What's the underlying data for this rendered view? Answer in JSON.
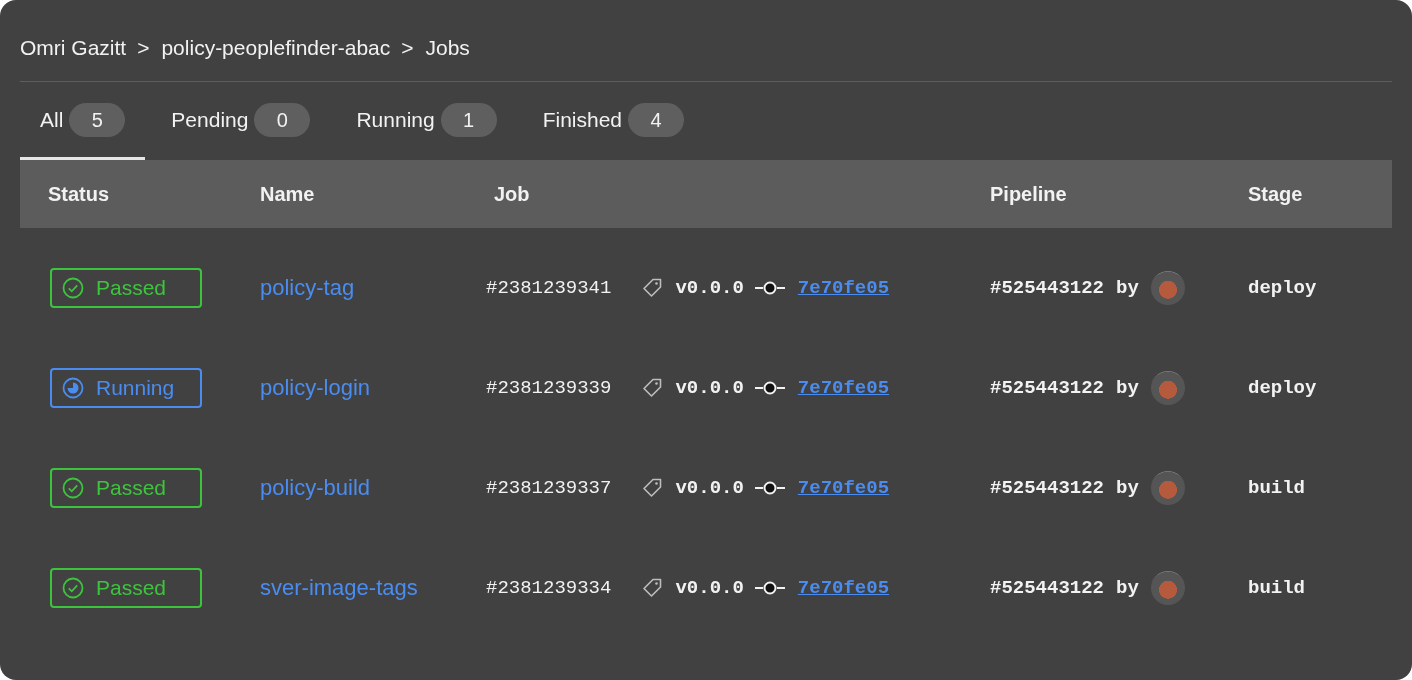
{
  "breadcrumb": {
    "separator": ">",
    "items": [
      {
        "label": "Omri Gazitt"
      },
      {
        "label": "policy-peoplefinder-abac"
      },
      {
        "label": "Jobs"
      }
    ]
  },
  "tabs": [
    {
      "label": "All",
      "count": "5",
      "selected": true
    },
    {
      "label": "Pending",
      "count": "0",
      "selected": false
    },
    {
      "label": "Running",
      "count": "1",
      "selected": false
    },
    {
      "label": "Finished",
      "count": "4",
      "selected": false
    }
  ],
  "table": {
    "columns": [
      "Status",
      "Name",
      "Job",
      "Pipeline",
      "Stage"
    ],
    "rows": [
      {
        "status": {
          "kind": "passed",
          "label": "Passed"
        },
        "name": "policy-tag",
        "job_id": "#2381239341",
        "tag": "v0.0.0",
        "commit": "7e70fe05",
        "pipeline": "#525443122",
        "by": "by",
        "stage": "deploy"
      },
      {
        "status": {
          "kind": "running",
          "label": "Running"
        },
        "name": "policy-login",
        "job_id": "#2381239339",
        "tag": "v0.0.0",
        "commit": "7e70fe05",
        "pipeline": "#525443122",
        "by": "by",
        "stage": "deploy"
      },
      {
        "status": {
          "kind": "passed",
          "label": "Passed"
        },
        "name": "policy-build",
        "job_id": "#2381239337",
        "tag": "v0.0.0",
        "commit": "7e70fe05",
        "pipeline": "#525443122",
        "by": "by",
        "stage": "build"
      },
      {
        "status": {
          "kind": "passed",
          "label": "Passed"
        },
        "name": "sver-image-tags",
        "job_id": "#2381239334",
        "tag": "v0.0.0",
        "commit": "7e70fe05",
        "pipeline": "#525443122",
        "by": "by",
        "stage": "build"
      }
    ]
  }
}
